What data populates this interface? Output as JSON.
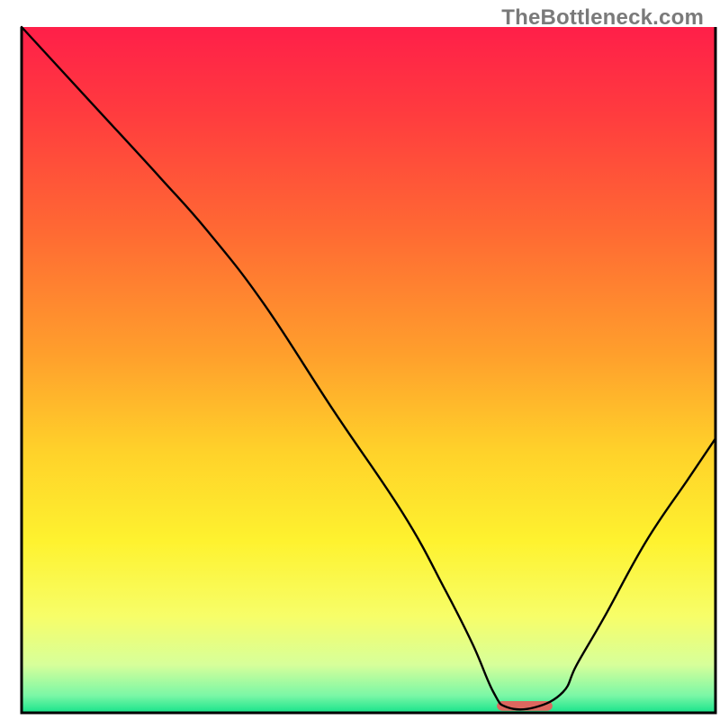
{
  "watermark": "TheBottleneck.com",
  "chart_data": {
    "type": "line",
    "title": "",
    "xlabel": "",
    "ylabel": "",
    "xlim": [
      0,
      100
    ],
    "ylim": [
      0,
      100
    ],
    "axes_visible": false,
    "background_gradient": {
      "direction": "vertical",
      "stops": [
        {
          "offset": 0.0,
          "color": "#ff1f49"
        },
        {
          "offset": 0.12,
          "color": "#ff3a3f"
        },
        {
          "offset": 0.3,
          "color": "#ff6a33"
        },
        {
          "offset": 0.48,
          "color": "#ffa02c"
        },
        {
          "offset": 0.62,
          "color": "#ffd22a"
        },
        {
          "offset": 0.75,
          "color": "#fef22f"
        },
        {
          "offset": 0.86,
          "color": "#f7fe69"
        },
        {
          "offset": 0.93,
          "color": "#d7ff9a"
        },
        {
          "offset": 0.975,
          "color": "#7af7a6"
        },
        {
          "offset": 1.0,
          "color": "#17e38b"
        }
      ]
    },
    "series": [
      {
        "name": "bottleneck-curve",
        "stroke": "#000000",
        "stroke_width": 2.4,
        "x": [
          0.0,
          10.0,
          20.0,
          27.0,
          35.0,
          45.0,
          55.0,
          61.0,
          65.0,
          68.0,
          70.0,
          74.0,
          78.0,
          80.0,
          84.0,
          90.0,
          96.0,
          100.0
        ],
        "y": [
          100.0,
          89.0,
          78.0,
          70.0,
          59.5,
          44.0,
          29.0,
          18.0,
          10.0,
          3.0,
          0.8,
          0.8,
          3.0,
          7.0,
          14.0,
          25.0,
          34.0,
          40.0
        ]
      }
    ],
    "annotations": [
      {
        "name": "optimal-band-marker",
        "shape": "rounded-rect",
        "fill": "#dd675f",
        "x_range": [
          68.5,
          76.5
        ],
        "y": 0.3,
        "height": 1.4
      }
    ],
    "frame": {
      "type": "open-box",
      "sides": [
        "left",
        "bottom",
        "right"
      ],
      "stroke": "#000000",
      "stroke_width": 3
    }
  }
}
